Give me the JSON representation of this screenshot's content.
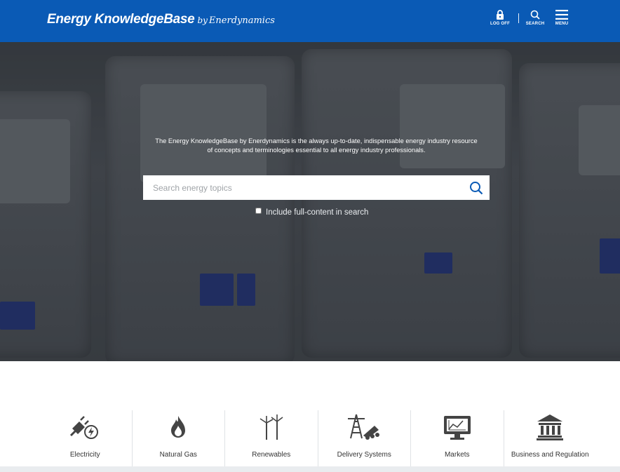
{
  "header": {
    "logo_main": "Energy KnowledgeBase",
    "logo_by": "by",
    "logo_sub": "Enerdynamics",
    "logoff_label": "LOG OFF",
    "search_label": "SEARCH",
    "menu_label": "MENU",
    "bg_color": "#0a5ab5"
  },
  "hero": {
    "tagline_line1": "The Energy KnowledgeBase by Enerdynamics is the always up-to-date, indispensable energy industry resource",
    "tagline_line2": "of concepts and terminologies essential to all energy industry professionals.",
    "search_placeholder": "Search energy topics",
    "search_value": "",
    "include_label": "Include full-content in search",
    "include_checked": false
  },
  "categories": [
    {
      "label": "Electricity",
      "icon": "electric-plug-icon"
    },
    {
      "label": "Natural Gas",
      "icon": "flame-icon"
    },
    {
      "label": "Renewables",
      "icon": "wind-turbine-icon"
    },
    {
      "label": "Delivery Systems",
      "icon": "transmission-tower-icon"
    },
    {
      "label": "Markets",
      "icon": "monitor-chart-icon"
    },
    {
      "label": "Business and Regulation",
      "icon": "government-building-icon"
    }
  ]
}
